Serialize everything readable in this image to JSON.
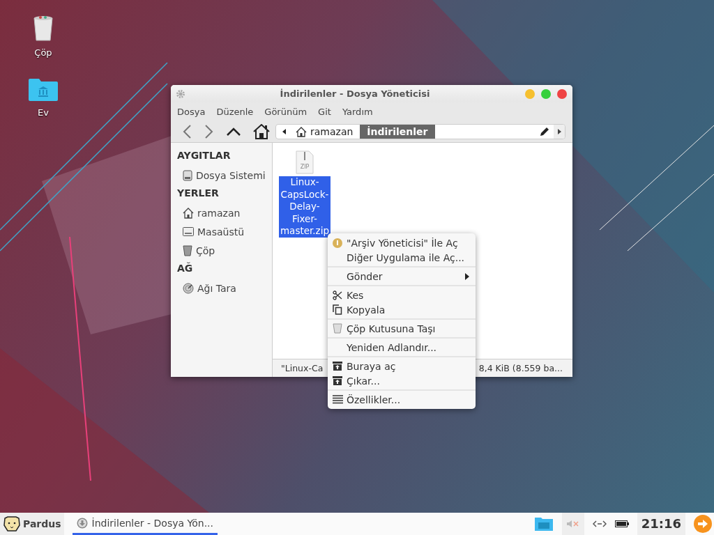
{
  "desktop_icons": [
    {
      "label": "Çöp",
      "kind": "trash"
    },
    {
      "label": "Ev",
      "kind": "home-folder"
    }
  ],
  "window": {
    "title": "İndirilenler - Dosya Yöneticisi",
    "menu_bar": [
      "Dosya",
      "Düzenle",
      "Görünüm",
      "Git",
      "Yardım"
    ],
    "path_bar": [
      {
        "label": "ramazan",
        "selected": false
      },
      {
        "label": "İndirilenler",
        "selected": true
      }
    ],
    "sidebar": [
      {
        "heading": "AYGITLAR",
        "items": [
          {
            "label": "Dosya Sistemi",
            "kind": "drive"
          }
        ]
      },
      {
        "heading": "YERLER",
        "items": [
          {
            "label": "ramazan",
            "kind": "home"
          },
          {
            "label": "Masaüstü",
            "kind": "desktop"
          },
          {
            "label": "Çöp",
            "kind": "trash"
          }
        ]
      },
      {
        "heading": "AĞ",
        "items": [
          {
            "label": "Ağı Tara",
            "kind": "network"
          }
        ]
      }
    ],
    "files": [
      {
        "type_label": "ZIP",
        "name": "Linux-CapsLock-Delay-Fixer-master.zip",
        "selected": true
      }
    ],
    "status_bar": {
      "left": "\"Linux-Ca",
      "right": "8,4 KiB (8.559 ba..."
    }
  },
  "context_menu": [
    [
      {
        "label": "\"Arşiv Yöneticisi\" İle Aç",
        "kind": "app"
      },
      {
        "label": "Diğer Uygulama ile Aç...",
        "kind": "plain"
      }
    ],
    [
      {
        "label": "Gönder",
        "kind": "submenu"
      }
    ],
    [
      {
        "label": "Kes",
        "kind": "cut"
      },
      {
        "label": "Kopyala",
        "kind": "copy"
      }
    ],
    [
      {
        "label": "Çöp Kutusuna Taşı",
        "kind": "trash"
      }
    ],
    [
      {
        "label": "Yeniden Adlandır...",
        "kind": "plain"
      }
    ],
    [
      {
        "label": "Buraya aç",
        "kind": "extract"
      },
      {
        "label": "Çıkar...",
        "kind": "extract"
      }
    ],
    [
      {
        "label": "Özellikler...",
        "kind": "properties"
      }
    ]
  ],
  "taskbar": {
    "start_label": "Pardus",
    "task": {
      "label": "İndirilenler - Dosya Yön...",
      "selected": true
    },
    "clock": "21:16"
  }
}
